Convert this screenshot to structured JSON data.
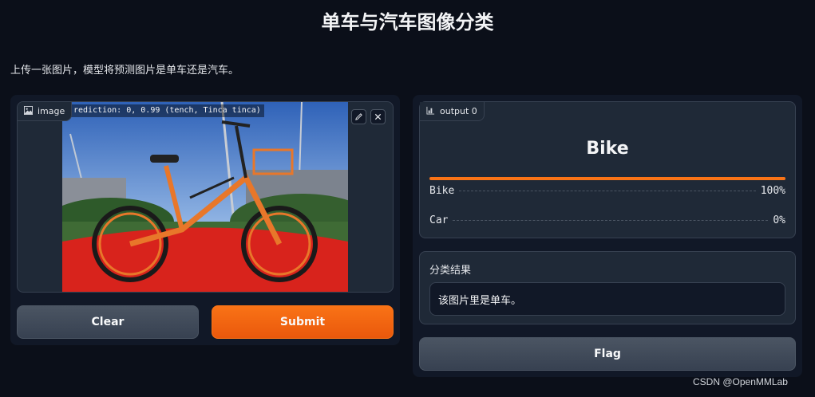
{
  "header": {
    "title": "单车与汽车图像分类",
    "description": "上传一张图片，模型将预测图片是单车还是汽车。"
  },
  "input": {
    "label": "image",
    "label_icon": "image-icon",
    "overlay_text": "rediction: 0, 0.99 (tench, Tinca tinca)",
    "edit_icon": "pencil-icon",
    "close_icon": "close-icon"
  },
  "buttons": {
    "clear": "Clear",
    "submit": "Submit",
    "flag": "Flag"
  },
  "output": {
    "label": "output 0",
    "label_icon": "bar-chart-icon",
    "predicted": "Bike",
    "confidences": [
      {
        "label": "Bike",
        "percent": "100%",
        "value": 1.0
      },
      {
        "label": "Car",
        "percent": "0%",
        "value": 0.0
      }
    ]
  },
  "result": {
    "label": "分类结果",
    "text": "该图片里是单车。"
  },
  "watermark": "CSDN @OpenMMLab",
  "colors": {
    "accent": "#f97316",
    "background": "#0b0f19",
    "panel": "#111827",
    "block": "#1f2937"
  }
}
